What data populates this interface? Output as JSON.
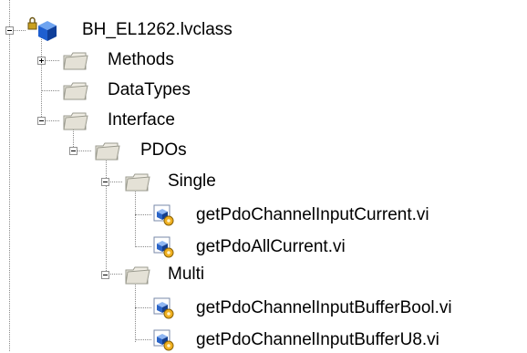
{
  "tree": {
    "root": {
      "label": "BH_EL1262.lvclass",
      "icon": "lvclass-icon",
      "expanded": true
    },
    "items": [
      {
        "id": "methods",
        "label": "Methods",
        "icon": "folder-icon",
        "expanded": false
      },
      {
        "id": "datatypes",
        "label": "DataTypes",
        "icon": "folder-icon"
      },
      {
        "id": "interface",
        "label": "Interface",
        "icon": "folder-icon",
        "expanded": true
      },
      {
        "id": "pdos",
        "label": "PDOs",
        "icon": "folder-icon",
        "expanded": true
      },
      {
        "id": "single",
        "label": "Single",
        "icon": "folder-icon",
        "expanded": true
      },
      {
        "id": "vi1",
        "label": "getPdoChannelInputCurrent.vi",
        "icon": "vi-icon"
      },
      {
        "id": "vi2",
        "label": "getPdoAllCurrent.vi",
        "icon": "vi-icon"
      },
      {
        "id": "multi",
        "label": "Multi",
        "icon": "folder-icon",
        "expanded": true
      },
      {
        "id": "vi3",
        "label": "getPdoChannelInputBufferBool.vi",
        "icon": "vi-icon"
      },
      {
        "id": "vi4",
        "label": "getPdoChannelInputBufferU8.vi",
        "icon": "vi-icon"
      }
    ]
  },
  "colors": {
    "folder_fill": "#f0ede4",
    "folder_stroke": "#9a9a8e",
    "lvclass_blue": "#1e5fd0",
    "vi_blue": "#2a64c8",
    "vi_badge": "#f0b020",
    "tree_line": "#8a8a8a"
  }
}
